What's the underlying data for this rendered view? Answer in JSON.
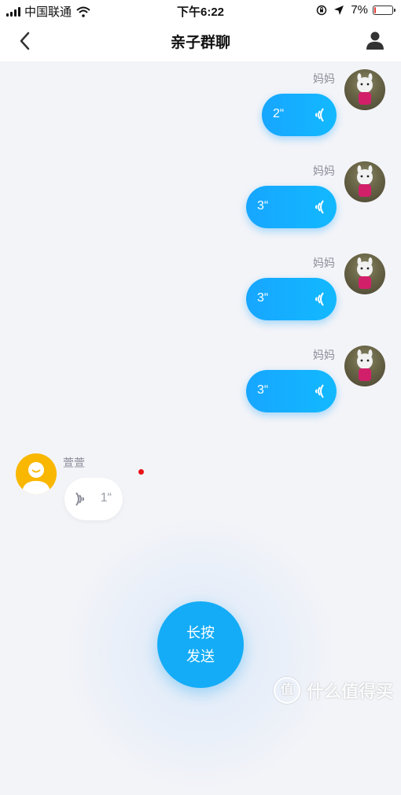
{
  "status_bar": {
    "carrier": "中国联通",
    "time": "下午6:22",
    "battery_percent": "7%",
    "battery_level": 0.07,
    "battery_color": "#e53935"
  },
  "nav": {
    "title": "亲子群聊",
    "back_icon": "chevron-left-icon",
    "profile_icon": "person-icon"
  },
  "messages": [
    {
      "sender": "妈妈",
      "direction": "outgoing",
      "duration": "2“"
    },
    {
      "sender": "妈妈",
      "direction": "outgoing",
      "duration": "3“"
    },
    {
      "sender": "妈妈",
      "direction": "outgoing",
      "duration": "3“"
    },
    {
      "sender": "妈妈",
      "direction": "outgoing",
      "duration": "3“"
    },
    {
      "sender": "萱萱",
      "direction": "incoming",
      "duration": "1“",
      "unread": true
    }
  ],
  "record_button": {
    "line1": "长按",
    "line2": "发送"
  },
  "watermark": {
    "text": "什么值得买",
    "logo_glyph": "值"
  },
  "colors": {
    "accent": "#14acf7",
    "bubble_out": "#17a6ff",
    "unread_dot": "#e8141a",
    "incoming_avatar": "#f9b700"
  }
}
